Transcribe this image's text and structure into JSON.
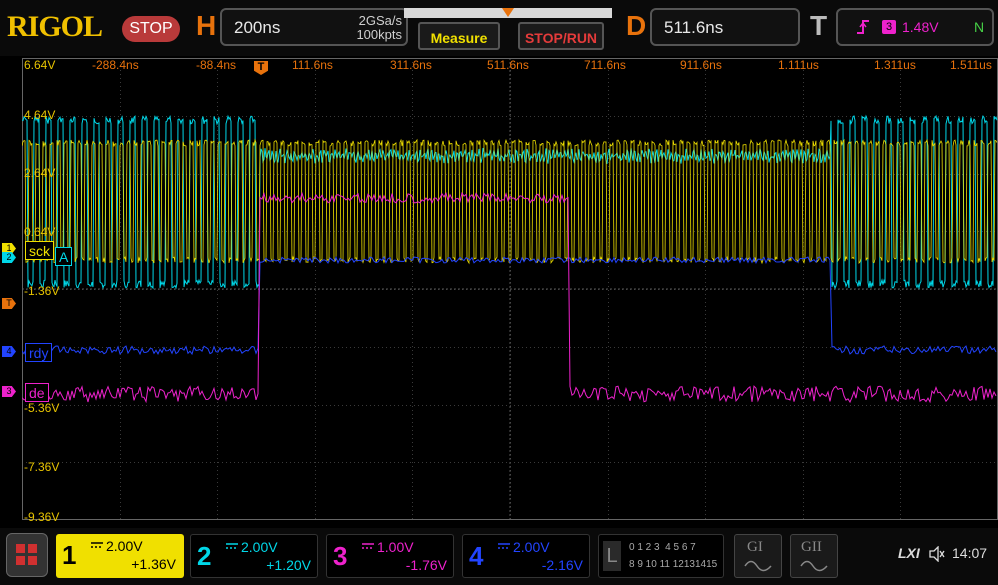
{
  "header": {
    "brand": "RIGOL",
    "run_state": "STOP",
    "horizontal": {
      "letter": "H",
      "timebase": "200ns",
      "sample_rate": "2GSa/s",
      "memory_depth": "100kpts"
    },
    "measure_label": "Measure",
    "stop_run_label": "STOP/RUN",
    "delay": {
      "letter": "D",
      "value": "511.6ns"
    },
    "trigger": {
      "letter": "T",
      "source": "3",
      "level": "1.48V",
      "sweep": "N",
      "edge_icon": "rising-edge-icon"
    }
  },
  "grid": {
    "time_labels": [
      "-288.4ns",
      "-88.4ns",
      "111.6ns",
      "311.6ns",
      "511.6ns",
      "711.6ns",
      "911.6ns",
      "1.111us",
      "1.311us",
      "1.511us"
    ],
    "volt_labels": [
      "6.64V",
      "4.64V",
      "2.64V",
      "0.64V",
      "-1.36V",
      "-5.36V",
      "-7.36V",
      "-9.36V"
    ],
    "trigger_marker": "T"
  },
  "channels": [
    {
      "num": "1",
      "tag": "sck",
      "scale": "2.00V",
      "offset": "+1.36V",
      "color": "#f0e000",
      "coupling": "DC"
    },
    {
      "num": "2",
      "tag": "A",
      "scale": "2.00V",
      "offset": "+1.20V",
      "color": "#00d7e8",
      "coupling": "DC"
    },
    {
      "num": "3",
      "tag": "de",
      "scale": "1.00V",
      "offset": "-1.76V",
      "color": "#ee22cc",
      "coupling": "DC"
    },
    {
      "num": "4",
      "tag": "rdy",
      "scale": "2.00V",
      "offset": "-2.16V",
      "color": "#2244ff",
      "coupling": "DC"
    }
  ],
  "footer": {
    "menu_icon": "grid-menu-icon",
    "logic_letter": "L",
    "logic_row1": "0 1 2 3  4 5 6 7",
    "logic_row2": "8 9 10 11 12131415",
    "math1": "GI",
    "math2": "GII",
    "lxi": "LXI",
    "speaker_icon": "speaker-muted-icon",
    "time": "14:07"
  },
  "colors": {
    "accent": "#e8720c",
    "ch1": "#f0e000",
    "ch2": "#00d7e8",
    "ch3": "#ee22cc",
    "ch4": "#2244ff",
    "stop": "#b93a3a"
  }
}
